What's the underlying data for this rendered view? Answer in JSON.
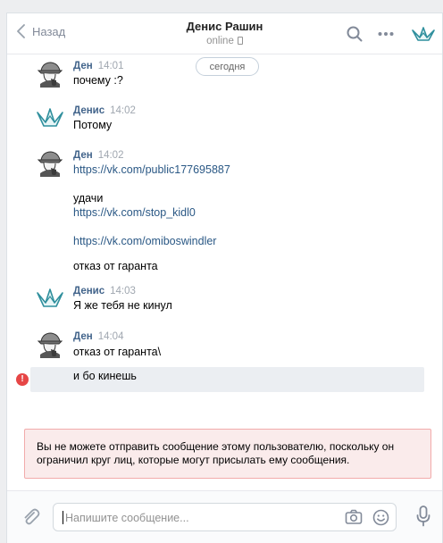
{
  "header": {
    "back_label": "Назад",
    "peer_name": "Денис Рашин",
    "peer_status": "online"
  },
  "history": {
    "date_label": "сегодня",
    "messages": [
      {
        "author": "Ден",
        "time": "14:01",
        "avatar": "detective-avatar-icon",
        "lines": [
          "почему :?"
        ]
      },
      {
        "author": "Денис",
        "time": "14:02",
        "avatar": "paper-boat-avatar-icon",
        "lines": [
          "Потому"
        ]
      },
      {
        "author": "Ден",
        "time": "14:02",
        "avatar": "detective-avatar-icon",
        "lines": [
          "https://vk.com/public177695887",
          "удачи",
          "https://vk.com/stop_kidl0",
          "https://vk.com/omiboswindler",
          "отказ от гаранта"
        ]
      },
      {
        "author": "Денис",
        "time": "14:03",
        "avatar": "paper-boat-avatar-icon",
        "lines": [
          "Я же тебя не кинул"
        ]
      },
      {
        "author": "Ден",
        "time": "14:04",
        "avatar": "detective-avatar-icon",
        "lines": [
          "отказ от гаранта\\",
          "и бо кинешь"
        ]
      }
    ]
  },
  "notice": {
    "text": "Вы не можете отправить сообщение этому пользователю, поскольку он ограничил круг лиц, которые могут присылать ему сообщения."
  },
  "composer": {
    "placeholder": "Напишите сообщение..."
  },
  "colors": {
    "link": "#2a5885",
    "author": "#42648b",
    "error": "#e64646",
    "notice_bg": "#faebeb"
  }
}
